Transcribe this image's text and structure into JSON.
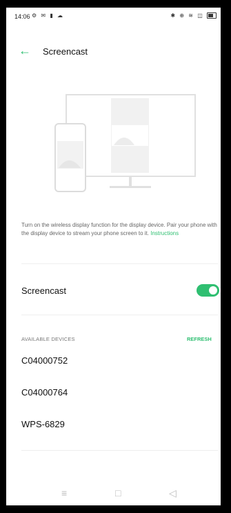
{
  "status_bar": {
    "time": "14:06",
    "left_icons": "⚙ ✉ ▮ ☁",
    "right_icons": "✱ ⊕ ≋ ◫"
  },
  "header": {
    "title": "Screencast"
  },
  "description": {
    "text": "Turn on the wireless display function for the display device. Pair your phone with the display device to stream your phone screen to it. ",
    "link": "Instructions"
  },
  "screencast": {
    "label": "Screencast",
    "enabled": true
  },
  "available_devices": {
    "title": "AVAILABLE DEVICES",
    "refresh": "REFRESH",
    "devices": [
      {
        "name": "C04000752"
      },
      {
        "name": "C04000764"
      },
      {
        "name": "WPS-6829"
      }
    ]
  },
  "navbar": {
    "menu_icon": "≡",
    "home_icon": "□",
    "back_icon": "◁"
  },
  "colors": {
    "accent": "#2fbf71",
    "illustration": "#e0e0e0"
  }
}
